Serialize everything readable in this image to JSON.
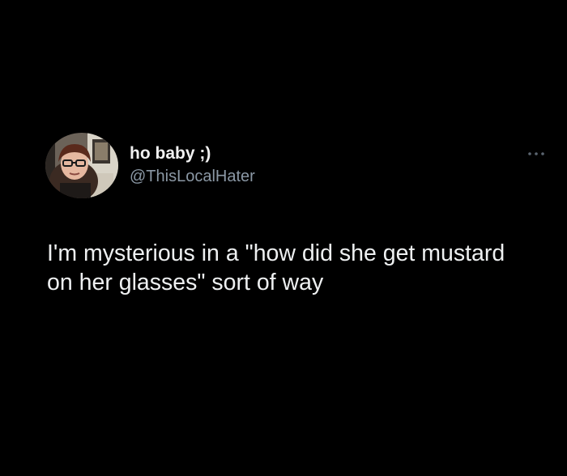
{
  "tweet": {
    "display_name": "ho baby ;)",
    "handle": "@ThisLocalHater",
    "text": "I'm mysterious in a \"how did she get mustard on her glasses\" sort of way",
    "avatar_icon": "profile-photo",
    "more_icon": "more-options-icon"
  },
  "colors": {
    "background": "#000000",
    "primary_text": "#e7e9ea",
    "secondary_text": "#8b98a5"
  }
}
